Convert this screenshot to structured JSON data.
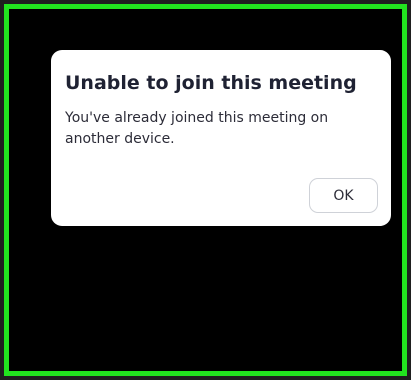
{
  "dialog": {
    "title": "Unable to join this meeting",
    "message": "You've already joined this meeting on another device.",
    "ok_label": "OK"
  },
  "colors": {
    "screen_border": "#22e41f",
    "screen_background": "#000000",
    "dialog_background": "#ffffff",
    "title_text": "#1f2233",
    "body_text": "#2c2c38",
    "button_border": "#cfd2d8"
  }
}
